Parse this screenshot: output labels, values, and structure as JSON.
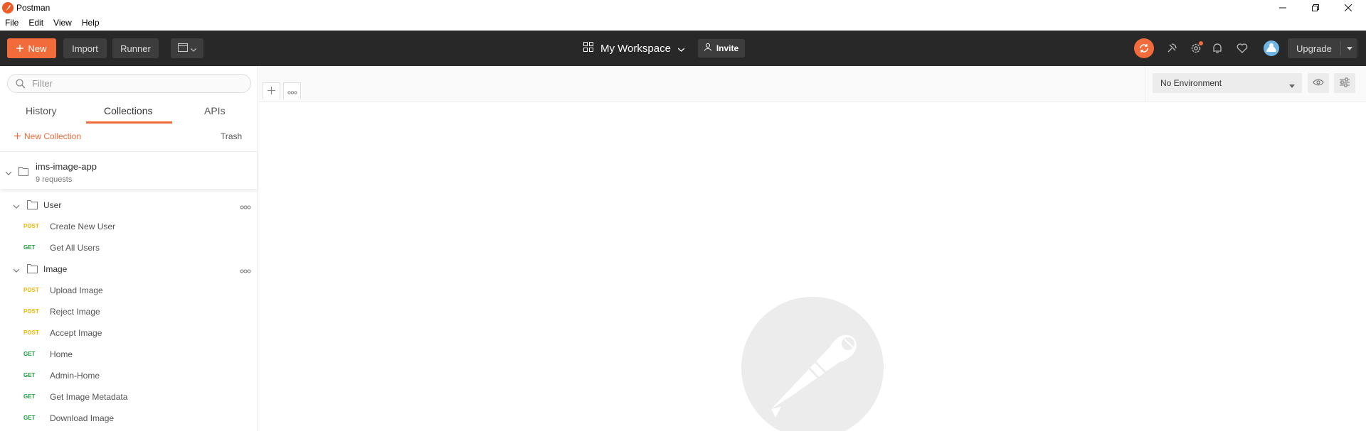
{
  "window": {
    "title": "Postman"
  },
  "menu": [
    "File",
    "Edit",
    "View",
    "Help"
  ],
  "header": {
    "new_label": "New",
    "import_label": "Import",
    "runner_label": "Runner",
    "workspace_label": "My Workspace",
    "invite_label": "Invite",
    "upgrade_label": "Upgrade"
  },
  "sidebar": {
    "filter_placeholder": "Filter",
    "tabs": [
      "History",
      "Collections",
      "APIs"
    ],
    "active_tab": "Collections",
    "new_collection_label": "New Collection",
    "trash_label": "Trash",
    "collection": {
      "name": "ims-image-app",
      "count": "9 requests",
      "folders": [
        {
          "name": "User",
          "requests": [
            {
              "method": "POST",
              "name": "Create New User"
            },
            {
              "method": "GET",
              "name": "Get All Users"
            }
          ]
        },
        {
          "name": "Image",
          "requests": [
            {
              "method": "POST",
              "name": "Upload Image"
            },
            {
              "method": "POST",
              "name": "Reject Image"
            },
            {
              "method": "POST",
              "name": "Accept Image"
            },
            {
              "method": "GET",
              "name": "Home"
            },
            {
              "method": "GET",
              "name": "Admin-Home"
            },
            {
              "method": "GET",
              "name": "Get Image Metadata"
            },
            {
              "method": "GET",
              "name": "Download Image"
            }
          ]
        }
      ]
    }
  },
  "main": {
    "environment_label": "No Environment"
  },
  "colors": {
    "accent": "#f26b3a",
    "header_bg": "#282828",
    "post_method": "#f4b400",
    "get_method": "#1b9e3e"
  },
  "icons": [
    "postman-logo-icon",
    "minimize-icon",
    "maximize-icon",
    "close-icon",
    "plus-icon",
    "new-window-icon",
    "grid-icon",
    "chevron-down-icon",
    "add-user-icon",
    "sync-icon",
    "satellite-icon",
    "gear-icon",
    "bell-icon",
    "heart-icon",
    "search-icon",
    "folder-icon",
    "more-icon",
    "eye-icon",
    "sliders-icon"
  ]
}
